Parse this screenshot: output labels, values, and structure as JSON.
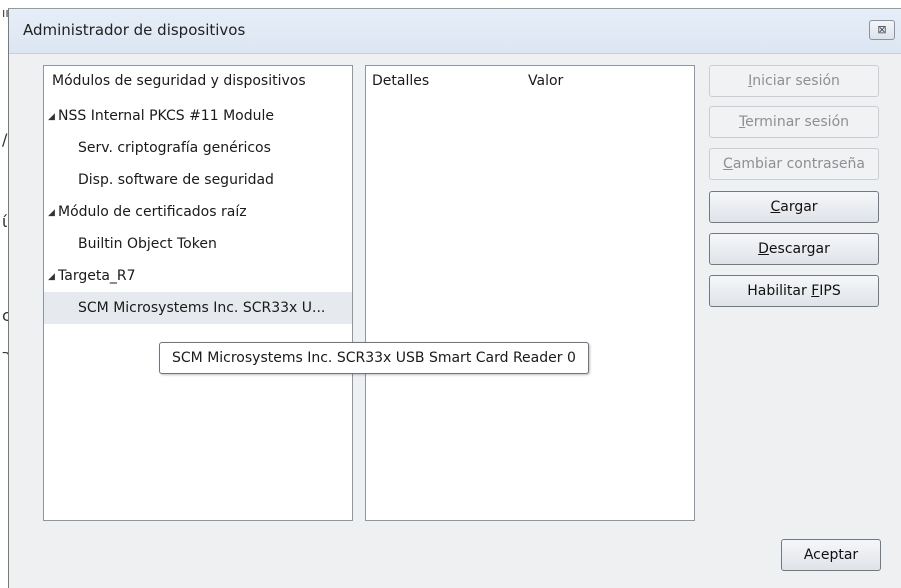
{
  "window": {
    "title": "Administrador de dispositivos",
    "close_symbol": "⊠"
  },
  "left_panel": {
    "header": "Módulos de seguridad y dispositivos",
    "tree": [
      {
        "label": "NSS Internal PKCS #11 Module",
        "level": 0,
        "expanded": true
      },
      {
        "label": "Serv. criptografía genéricos",
        "level": 1
      },
      {
        "label": "Disp. software de seguridad",
        "level": 1
      },
      {
        "label": "Módulo de certificados raíz",
        "level": 0,
        "expanded": true
      },
      {
        "label": "Builtin Object Token",
        "level": 1
      },
      {
        "label": "Targeta_R7",
        "level": 0,
        "expanded": true
      },
      {
        "label": "SCM Microsystems Inc. SCR33x U...",
        "level": 1,
        "selected": true
      }
    ],
    "expander_glyph": "◢"
  },
  "details_panel": {
    "col_details": "Detalles",
    "col_value": "Valor"
  },
  "buttons": {
    "login": {
      "pre": "",
      "key": "I",
      "post": "niciar sesión",
      "enabled": false
    },
    "logout": {
      "pre": "",
      "key": "T",
      "post": "erminar sesión",
      "enabled": false
    },
    "change_password": {
      "pre": "",
      "key": "C",
      "post": "ambiar contraseña",
      "enabled": false
    },
    "load": {
      "pre": "",
      "key": "C",
      "post": "argar",
      "enabled": true
    },
    "unload": {
      "pre": "",
      "key": "D",
      "post": "escargar",
      "enabled": true
    },
    "enable_fips": {
      "pre": "Habilitar ",
      "key": "F",
      "post": "IPS",
      "enabled": true
    },
    "ok": {
      "label": "Aceptar"
    }
  },
  "tooltip": {
    "text": "SCM Microsystems Inc. SCR33x USB Smart Card Reader 0"
  }
}
